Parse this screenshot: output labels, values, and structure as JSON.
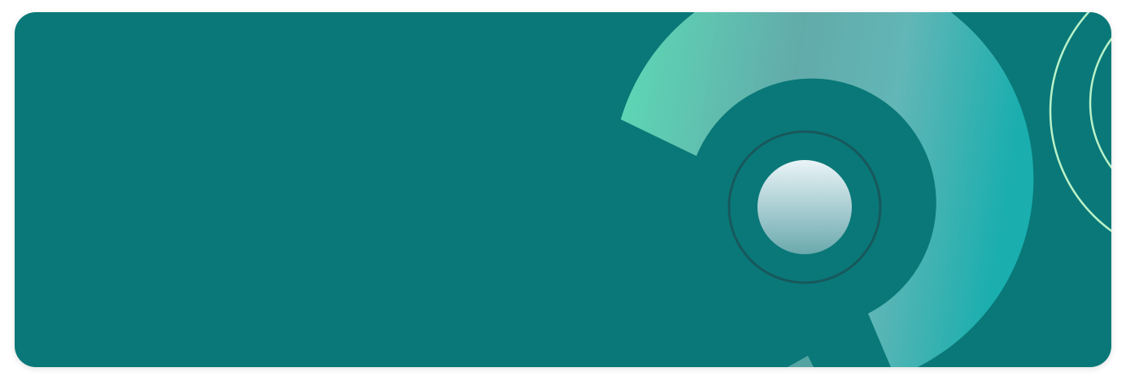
{
  "colors": {
    "background": "#0a7878",
    "ring_gradient_start": "#5ddbb6",
    "ring_gradient_mid": "#62abaa",
    "ring_gradient_end": "#1aaeae",
    "orbit_outline": "#17585c",
    "center_circle_top": "#eaf4f8",
    "center_circle_bottom": "#6aa9ad",
    "outer_arc_stroke": "#b9f2c9"
  },
  "decor": {
    "center_circle_icon": "circle",
    "ring_icon": "arc-ring",
    "outer_arcs_icon": "concentric-arcs"
  }
}
